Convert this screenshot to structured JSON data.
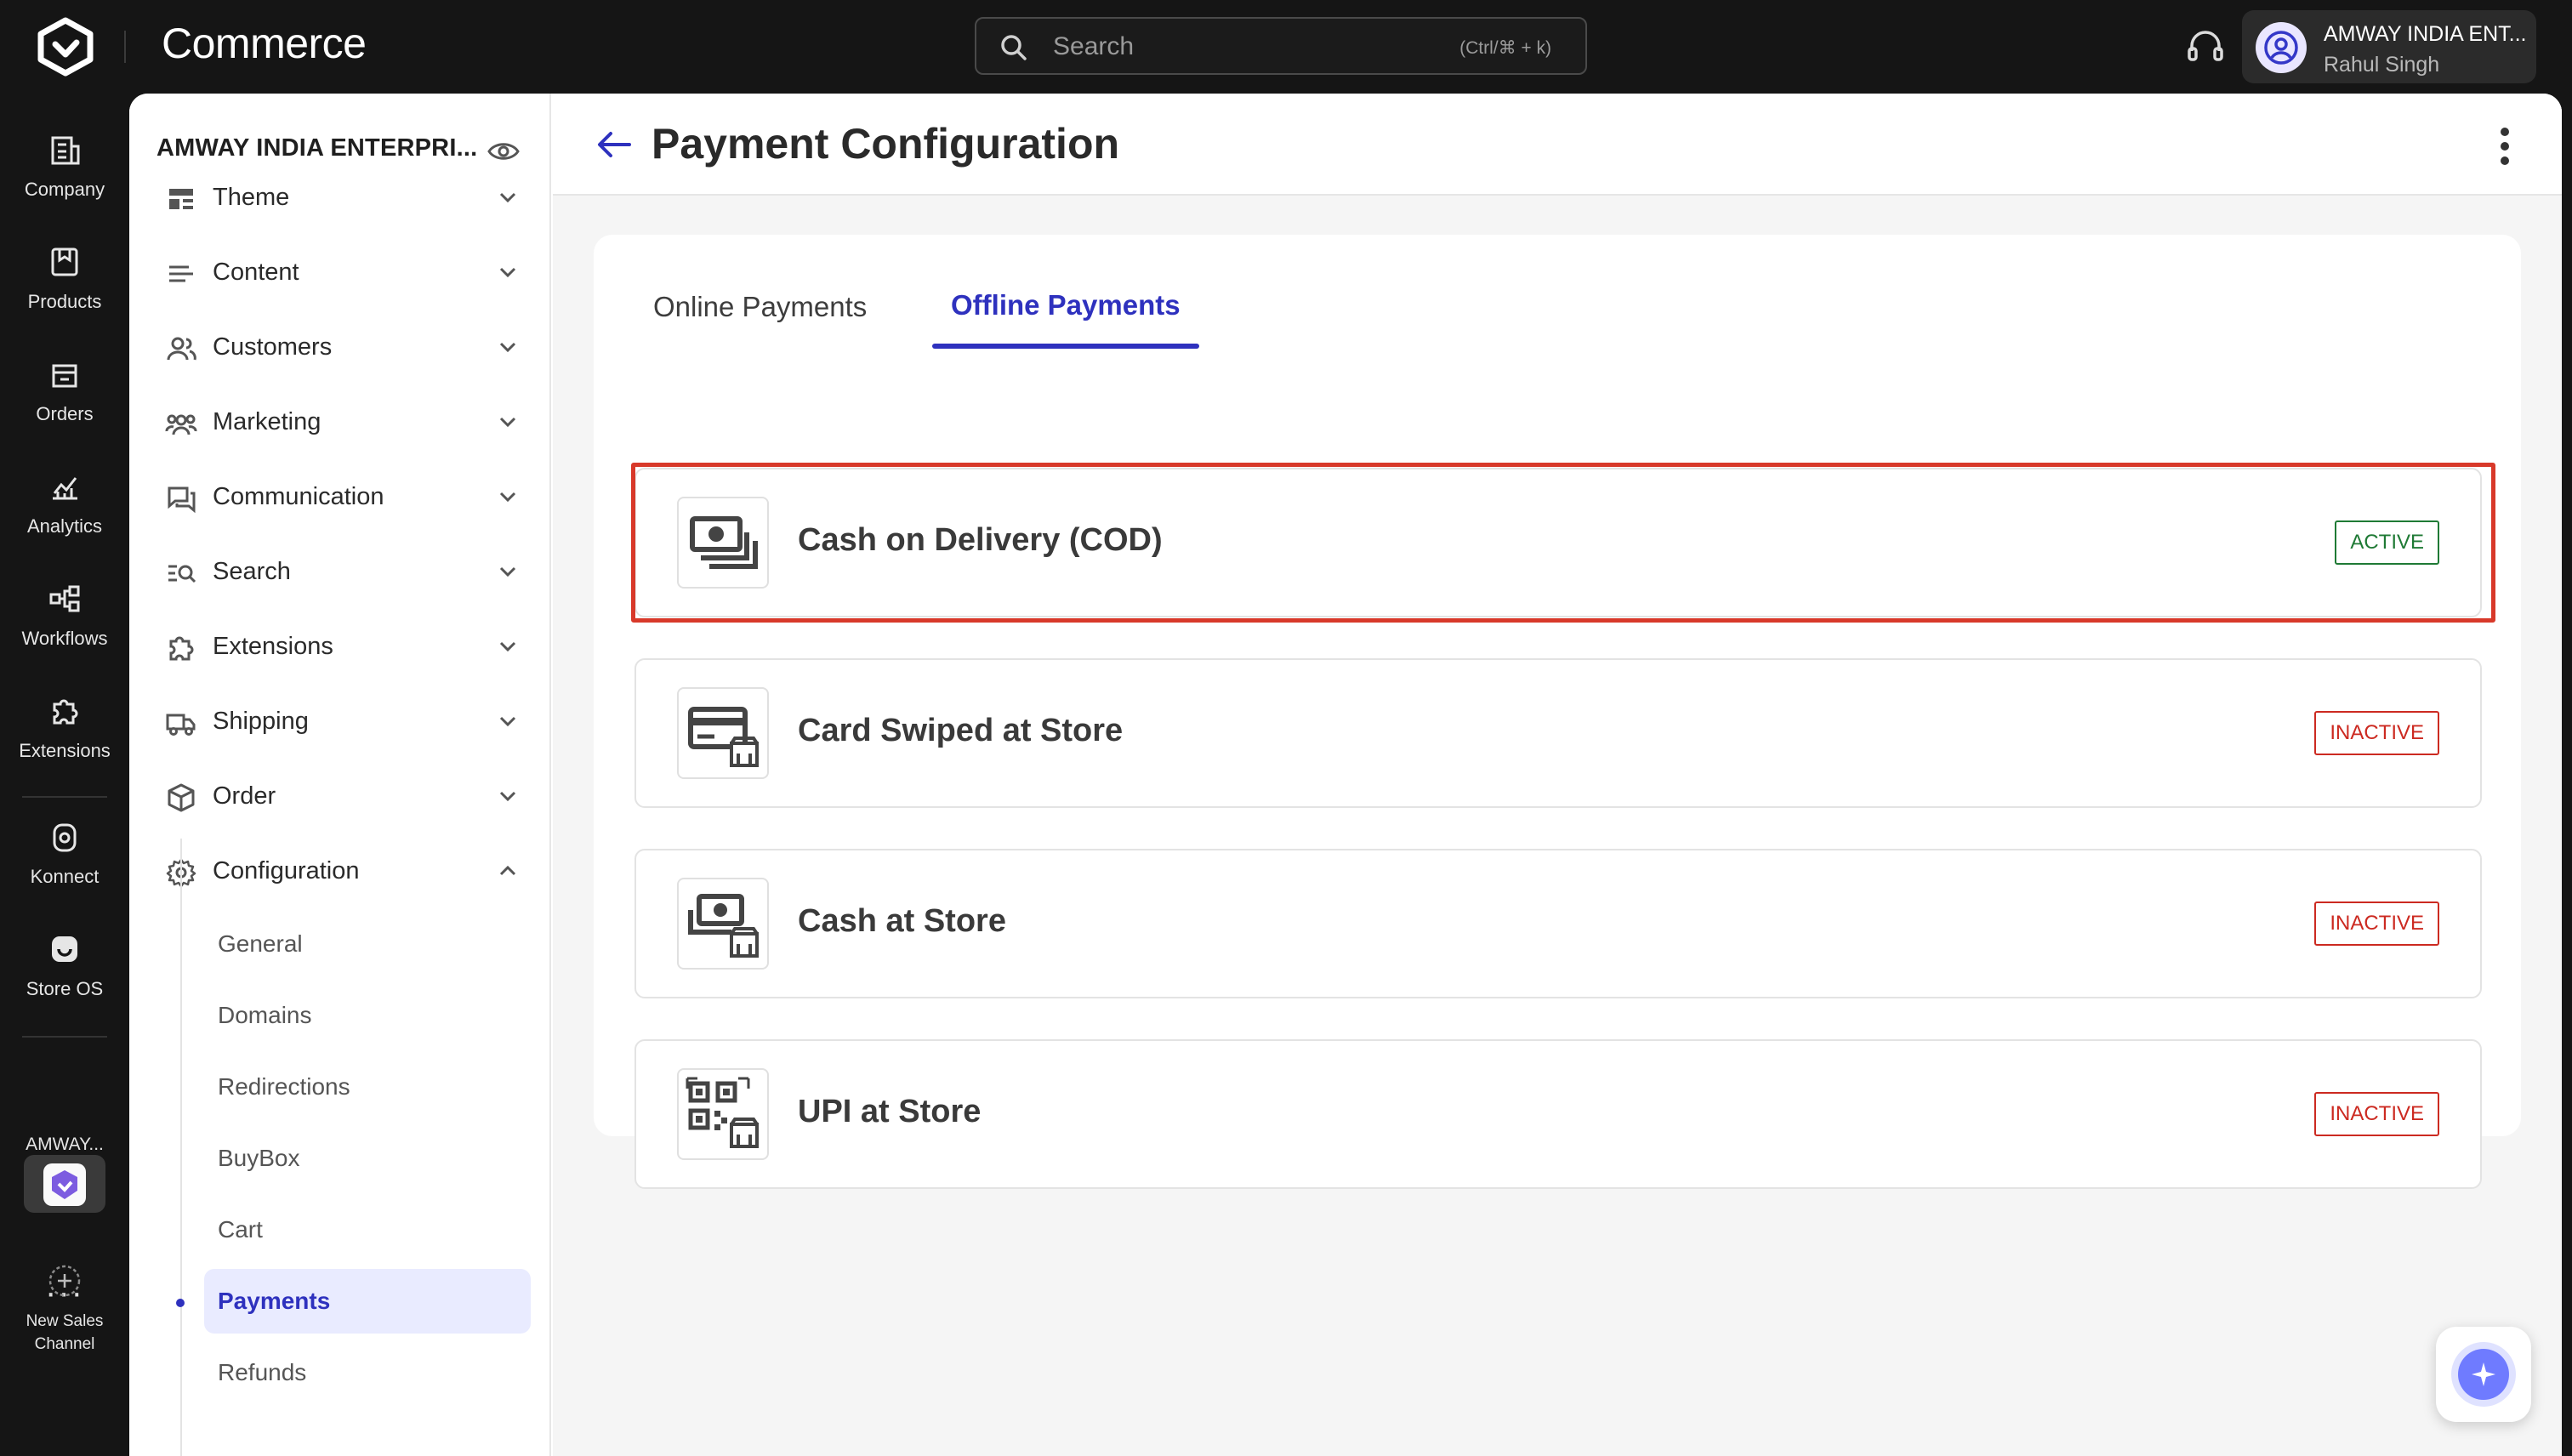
{
  "app": {
    "brand": "Commerce"
  },
  "search": {
    "placeholder": "Search",
    "shortcut": "(Ctrl/⌘ + k)"
  },
  "account": {
    "org": "AMWAY INDIA ENT...",
    "user": "Rahul Singh"
  },
  "rail": {
    "items": [
      {
        "label": "Company",
        "icon": "building-icon"
      },
      {
        "label": "Products",
        "icon": "box-icon"
      },
      {
        "label": "Orders",
        "icon": "orders-icon"
      },
      {
        "label": "Analytics",
        "icon": "analytics-icon"
      },
      {
        "label": "Workflows",
        "icon": "workflow-icon"
      },
      {
        "label": "Extensions",
        "icon": "puzzle-icon"
      },
      {
        "label": "Konnect",
        "icon": "konnect-icon"
      },
      {
        "label": "Store OS",
        "icon": "store-os-icon"
      }
    ],
    "app_label": "AMWAY...",
    "more": "···",
    "new_channel": "New Sales Channel"
  },
  "sidebar": {
    "company": "AMWAY INDIA ENTERPRI...",
    "items": [
      {
        "label": "Theme"
      },
      {
        "label": "Content"
      },
      {
        "label": "Customers"
      },
      {
        "label": "Marketing"
      },
      {
        "label": "Communication"
      },
      {
        "label": "Search"
      },
      {
        "label": "Extensions"
      },
      {
        "label": "Shipping"
      },
      {
        "label": "Order"
      },
      {
        "label": "Configuration"
      }
    ],
    "config_items": [
      {
        "label": "General"
      },
      {
        "label": "Domains"
      },
      {
        "label": "Redirections"
      },
      {
        "label": "BuyBox"
      },
      {
        "label": "Cart"
      },
      {
        "label": "Payments"
      },
      {
        "label": "Refunds"
      }
    ]
  },
  "page": {
    "title": "Payment Configuration"
  },
  "tabs": [
    {
      "label": "Online Payments",
      "selected": false
    },
    {
      "label": "Offline Payments",
      "selected": true
    }
  ],
  "payment_methods": [
    {
      "name": "Cash on Delivery (COD)",
      "status": "ACTIVE",
      "icon": "cash-stack-icon"
    },
    {
      "name": "Card Swiped at Store",
      "status": "INACTIVE",
      "icon": "card-store-icon"
    },
    {
      "name": "Cash at Store",
      "status": "INACTIVE",
      "icon": "cash-store-icon"
    },
    {
      "name": "UPI at Store",
      "status": "INACTIVE",
      "icon": "qr-store-icon"
    }
  ],
  "colors": {
    "accent": "#2e31be",
    "active": "#1f7a35",
    "inactive": "#cc2a21",
    "highlight": "#d8392a",
    "topbar": "#151515"
  }
}
